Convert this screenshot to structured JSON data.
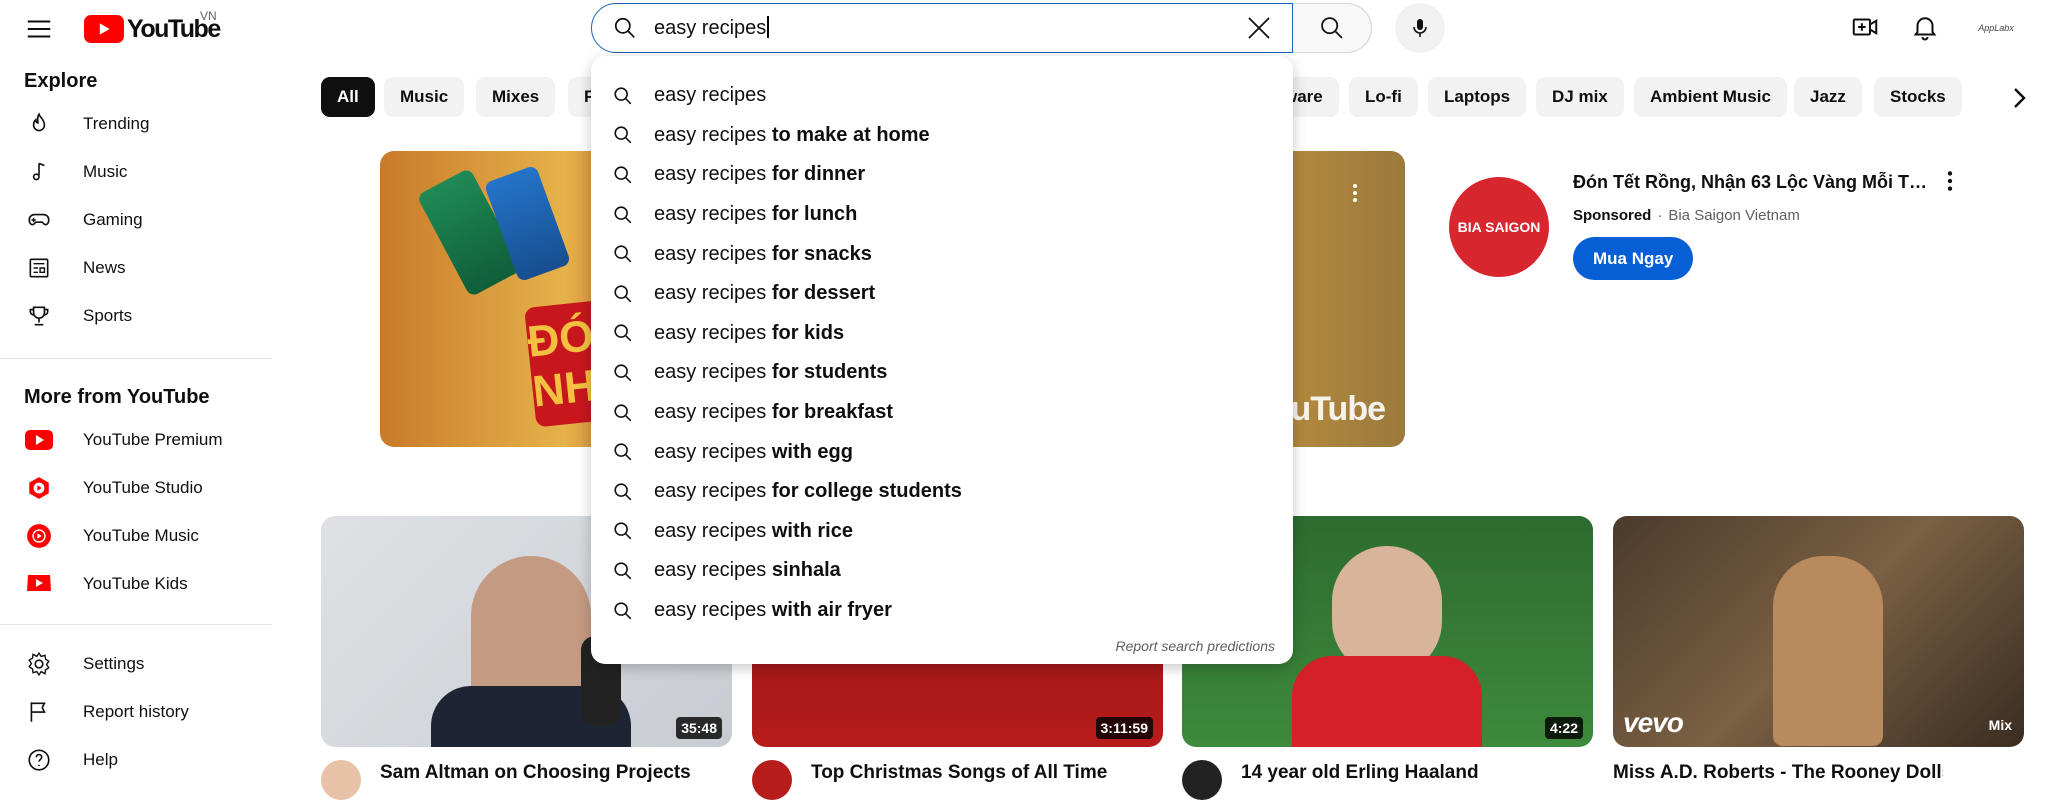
{
  "header": {
    "logo_text": "YouTube",
    "country": "VN",
    "search_value": "easy recipes",
    "account_label": "AppLabx"
  },
  "sidebar": {
    "explore_title": "Explore",
    "explore": [
      {
        "label": "Trending",
        "icon": "trending-icon"
      },
      {
        "label": "Music",
        "icon": "music-icon"
      },
      {
        "label": "Gaming",
        "icon": "gaming-icon"
      },
      {
        "label": "News",
        "icon": "news-icon"
      },
      {
        "label": "Sports",
        "icon": "sports-icon"
      }
    ],
    "more_title": "More from YouTube",
    "more": [
      {
        "label": "YouTube Premium",
        "icon": "youtube-premium-icon"
      },
      {
        "label": "YouTube Studio",
        "icon": "youtube-studio-icon"
      },
      {
        "label": "YouTube Music",
        "icon": "youtube-music-icon"
      },
      {
        "label": "YouTube Kids",
        "icon": "youtube-kids-icon"
      }
    ],
    "settings": [
      {
        "label": "Settings",
        "icon": "gear-icon"
      },
      {
        "label": "Report history",
        "icon": "flag-icon"
      },
      {
        "label": "Help",
        "icon": "help-icon"
      }
    ]
  },
  "chips": [
    "All",
    "Music",
    "Mixes",
    "F",
    "ware",
    "Lo-fi",
    "Laptops",
    "DJ mix",
    "Ambient Music",
    "Jazz",
    "Stocks"
  ],
  "suggestions": {
    "prefix": "easy recipes",
    "items": [
      "",
      " to make at home",
      " for dinner",
      " for lunch",
      " for snacks",
      " for dessert",
      " for kids",
      " for students",
      " for breakfast",
      " with egg",
      " for college students",
      " with rice",
      " sinhala",
      " with air fryer"
    ],
    "report_label": "Report search predictions"
  },
  "ad": {
    "promo_text": "ĐÓ NH",
    "watermark": "YouTube",
    "brand_logo": "BIA SAIGON",
    "title": "Đón Tết Rồng, Nhận 63 Lộc Vàng Mỗi Tối Th...",
    "sponsored": "Sponsored",
    "advertiser": "Bia Saigon Vietnam",
    "cta": "Mua Ngay"
  },
  "videos": [
    {
      "duration": "35:48",
      "title": "Sam Altman on Choosing Projects"
    },
    {
      "duration": "3:11:59",
      "title": "Top Christmas Songs of All Time"
    },
    {
      "duration": "4:22",
      "title": "14 year old Erling Haaland"
    },
    {
      "title": "Miss A.D. Roberts - The Rooney Dolls",
      "badge": "Mix",
      "brand": "vevo"
    }
  ],
  "colors": {
    "brand_red": "#ff0000",
    "focus_blue": "#1c62b9",
    "cta_blue": "#065fd4"
  }
}
